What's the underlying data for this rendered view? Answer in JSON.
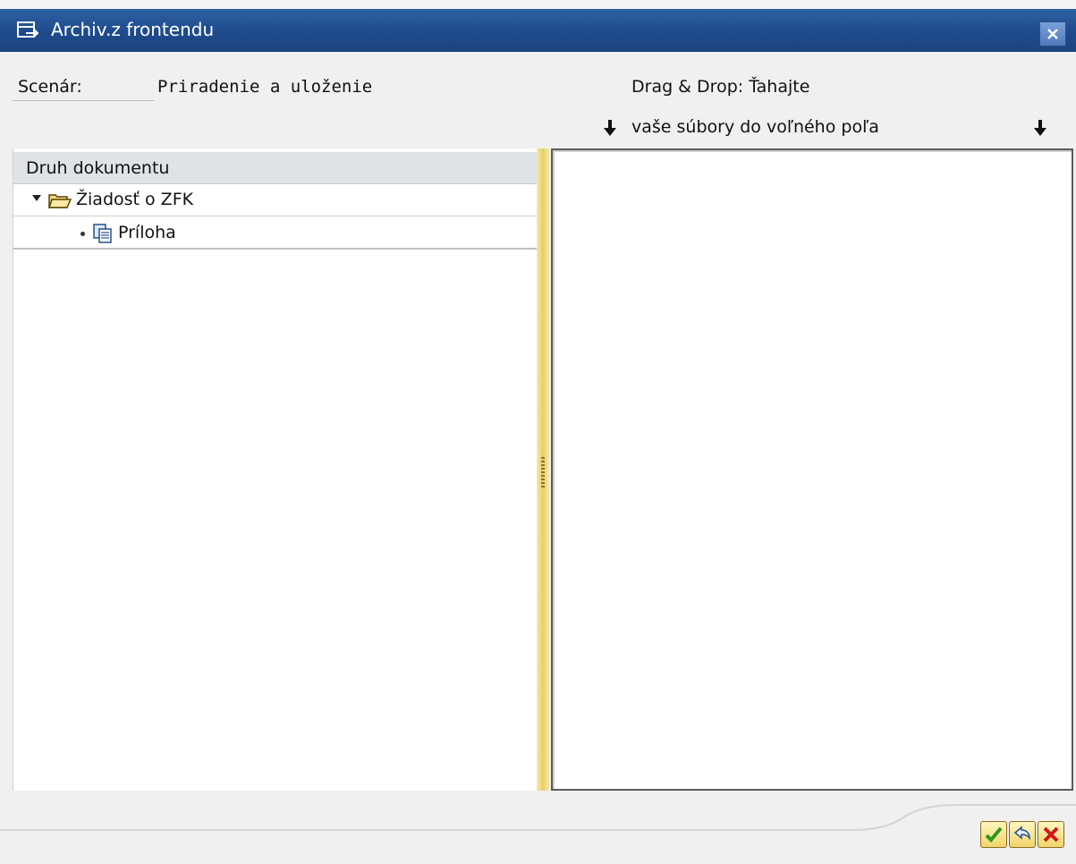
{
  "window": {
    "title": "Archiv.z frontendu",
    "icon": "popup-window-icon",
    "close_icon": "close-icon"
  },
  "form": {
    "scenario_label": "Scenár:",
    "scenario_value": "Priradenie a uloženie",
    "dragdrop_line1": "Drag & Drop: Ťahajte",
    "dragdrop_line2": "vaše súbory do voľného poľa",
    "arrow_icon": "arrow-down-icon"
  },
  "tree": {
    "header": "Druh dokumentu",
    "items": [
      {
        "label": "Žiadosť o ZFK",
        "icon": "folder-open-icon",
        "expanded": true
      },
      {
        "label": "Príloha",
        "icon": "document-attachment-icon"
      }
    ]
  },
  "footer": {
    "buttons": [
      {
        "name": "confirm",
        "icon": "checkmark-icon"
      },
      {
        "name": "undo",
        "icon": "undo-icon"
      },
      {
        "name": "cancel",
        "icon": "cancel-x-icon"
      }
    ]
  },
  "colors": {
    "titlebar": "#1e4a8c",
    "splitter": "#e7cf67",
    "button_face": "#f1d56c",
    "confirm_green": "#2e9a1a",
    "cancel_red": "#d01818"
  }
}
